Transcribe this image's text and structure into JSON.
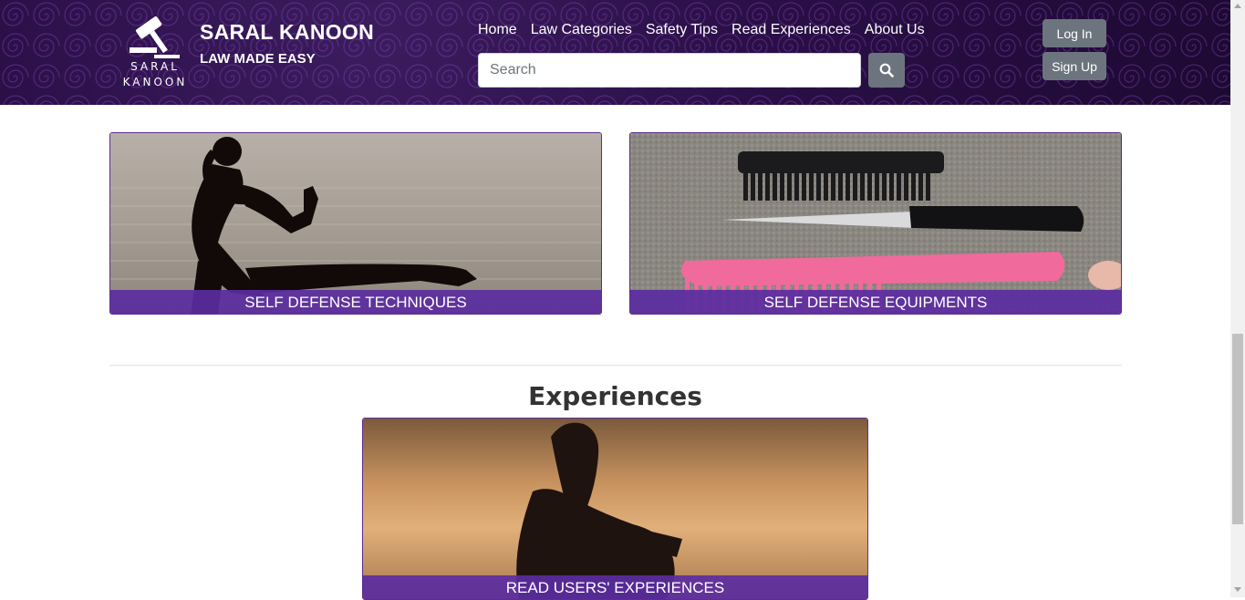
{
  "brand": {
    "logo_text_line1": "SARAL",
    "logo_text_line2": "KANOON",
    "title": "SARAL KANOON",
    "tagline": "LAW MADE EASY"
  },
  "nav": {
    "links": [
      "Home",
      "Law Categories",
      "Safety Tips",
      "Read Experiences",
      "About Us"
    ]
  },
  "search": {
    "placeholder": "Search",
    "value": "",
    "button_icon": "search-icon"
  },
  "auth": {
    "login_label": "Log In",
    "signup_label": "Sign Up"
  },
  "cards": {
    "self_defense_techniques": "SELF DEFENSE TECHNIQUES",
    "self_defense_equipments": "SELF DEFENSE EQUIPMENTS",
    "read_experiences": "READ USERS' EXPERIENCES"
  },
  "sections": {
    "experiences_title": "Experiences"
  },
  "colors": {
    "navbar_bg": "#2a0f47",
    "caption_bg": "#5b2da0",
    "button_gray": "#6c757d"
  }
}
